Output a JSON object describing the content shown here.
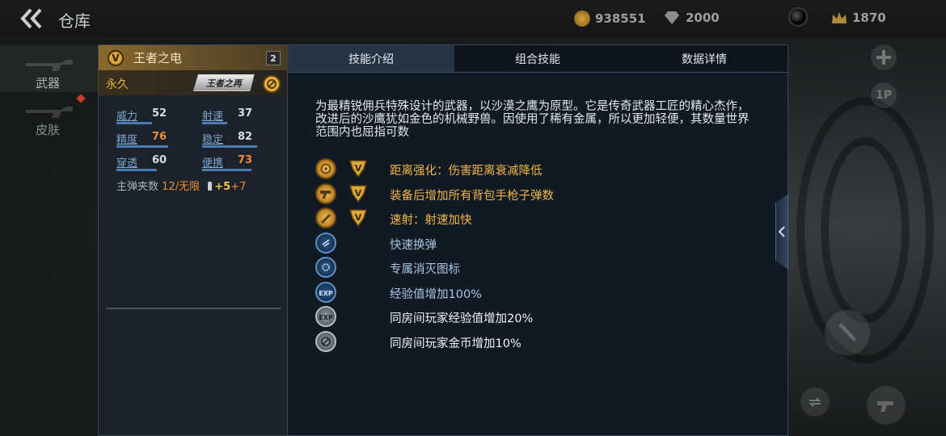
{
  "header": {
    "title": "仓库",
    "currencies": [
      {
        "icon": "gold-coin-icon",
        "value": "938551"
      },
      {
        "icon": "diamond-icon",
        "value": "2000"
      },
      {
        "icon": "crown-icon",
        "value": "1870"
      }
    ]
  },
  "nav": {
    "items": [
      {
        "label": "武器",
        "active": true
      },
      {
        "label": "皮肤",
        "active": false,
        "badge": true
      }
    ]
  },
  "weapon": {
    "badge": "V",
    "name": "王者之电",
    "level": "2",
    "duration": "永久",
    "logo_text": "王者之再",
    "stats": [
      {
        "key": "威力",
        "value": "52",
        "level": 0.52
      },
      {
        "key": "射速",
        "value": "37",
        "level": 0.37
      },
      {
        "key": "精度",
        "value": "76",
        "level": 0.76,
        "highlight": true
      },
      {
        "key": "稳定",
        "value": "82",
        "level": 0.82
      },
      {
        "key": "穿透",
        "value": "60",
        "level": 0.6
      },
      {
        "key": "便携",
        "value": "73",
        "level": 0.73,
        "highlight": true
      }
    ],
    "ammo": {
      "label": "主弹夹数",
      "clip": "12",
      "separator": "/",
      "reserve": "无限",
      "bonus_a": "+5",
      "bonus_b": "+7"
    }
  },
  "tabs": [
    {
      "label": "技能介绍",
      "active": true
    },
    {
      "label": "组合技能",
      "active": false
    },
    {
      "label": "数据详情",
      "active": false
    }
  ],
  "description": "为最精锐佣兵特殊设计的武器，以沙漠之鹰为原型。它是传奇武器工匠的精心杰作，改进后的沙鹰犹如金色的机械野兽。因使用了稀有金属，所以更加轻便，其数量世界范围内也屈指可数",
  "skills": [
    {
      "icon": "range-target-icon",
      "style": "gold",
      "v": true,
      "text": "距离强化：伤害距离衰减降低",
      "color": "gold"
    },
    {
      "icon": "pistol-ammo-icon",
      "style": "gold",
      "v": true,
      "text": "装备后增加所有背包手枪子弹数",
      "color": "gold"
    },
    {
      "icon": "rapid-fire-icon",
      "style": "gold",
      "v": true,
      "text": "速射：射速加快",
      "color": "gold"
    },
    {
      "icon": "fast-reload-icon",
      "style": "blue",
      "v": false,
      "text": "快速换弹",
      "color": "blue"
    },
    {
      "icon": "kill-mark-icon",
      "style": "blue",
      "v": false,
      "text": "专属消灭图标",
      "color": "blue"
    },
    {
      "icon": "exp-icon",
      "style": "blue",
      "v": false,
      "text": "经验值增加100%",
      "color": "blue"
    },
    {
      "icon": "room-exp-icon",
      "style": "gray",
      "v": false,
      "text": "同房间玩家经验值增加20%",
      "color": "white"
    },
    {
      "icon": "room-gold-icon",
      "style": "gray",
      "v": false,
      "text": "同房间玩家金币增加10%",
      "color": "white"
    }
  ],
  "right_buttons": {
    "view_label": "1P"
  }
}
